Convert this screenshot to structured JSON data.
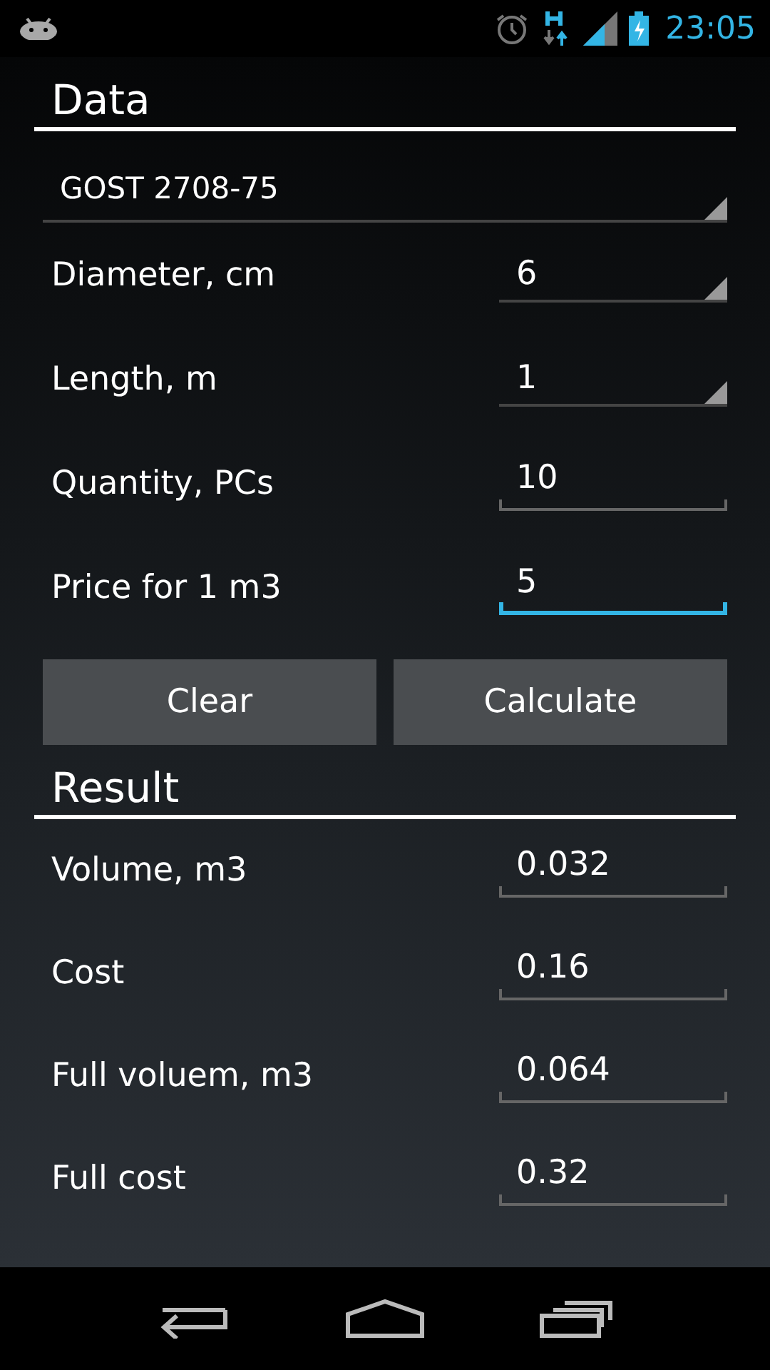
{
  "status_bar": {
    "time": "23:05"
  },
  "data_section": {
    "title": "Data",
    "standard": {
      "value": "GOST 2708-75"
    },
    "fields": [
      {
        "label": "Diameter, cm",
        "value": "6",
        "kind": "spinner",
        "focused": false
      },
      {
        "label": "Length, m",
        "value": "1",
        "kind": "spinner",
        "focused": false
      },
      {
        "label": "Quantity, PCs",
        "value": "10",
        "kind": "edit",
        "focused": false
      },
      {
        "label": "Price for 1 m3",
        "value": "5",
        "kind": "edit",
        "focused": true
      }
    ]
  },
  "buttons": [
    "Clear",
    "Calculate"
  ],
  "result_section": {
    "title": "Result",
    "fields": [
      {
        "label": "Volume, m3",
        "value": "0.032",
        "kind": "edit",
        "focused": false
      },
      {
        "label": "Cost",
        "value": "0.16",
        "kind": "edit",
        "focused": false
      },
      {
        "label": "Full voluem, m3",
        "value": "0.064",
        "kind": "edit",
        "focused": false
      },
      {
        "label": "Full cost",
        "value": "0.32",
        "kind": "edit",
        "focused": false
      }
    ]
  }
}
